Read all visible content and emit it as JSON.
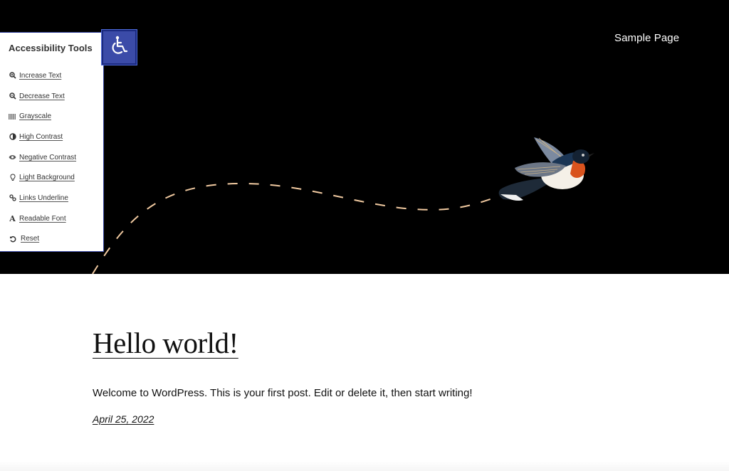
{
  "header": {
    "nav_items": [
      {
        "label": "Sample Page"
      }
    ]
  },
  "accessibility": {
    "title": "Accessibility Tools",
    "toggle_icon": "wheelchair-icon",
    "accent_color": "#3b4ba8",
    "items": [
      {
        "label": "Increase Text",
        "icon": "zoom-in-icon"
      },
      {
        "label": "Decrease Text",
        "icon": "zoom-out-icon"
      },
      {
        "label": "Grayscale",
        "icon": "barcode-icon"
      },
      {
        "label": "High Contrast",
        "icon": "contrast-icon"
      },
      {
        "label": "Negative Contrast",
        "icon": "eye-icon"
      },
      {
        "label": "Light Background",
        "icon": "lightbulb-icon"
      },
      {
        "label": "Links Underline",
        "icon": "link-icon"
      },
      {
        "label": "Readable Font",
        "icon": "font-icon"
      },
      {
        "label": "Reset",
        "icon": "reset-icon"
      }
    ]
  },
  "hero": {
    "background": "#000000",
    "path_color": "#f0c9a0",
    "image": "flying-bird-illustration"
  },
  "post": {
    "title": "Hello world!",
    "excerpt": "Welcome to WordPress. This is your first post. Edit or delete it, then start writing!",
    "date": "April 25, 2022"
  }
}
